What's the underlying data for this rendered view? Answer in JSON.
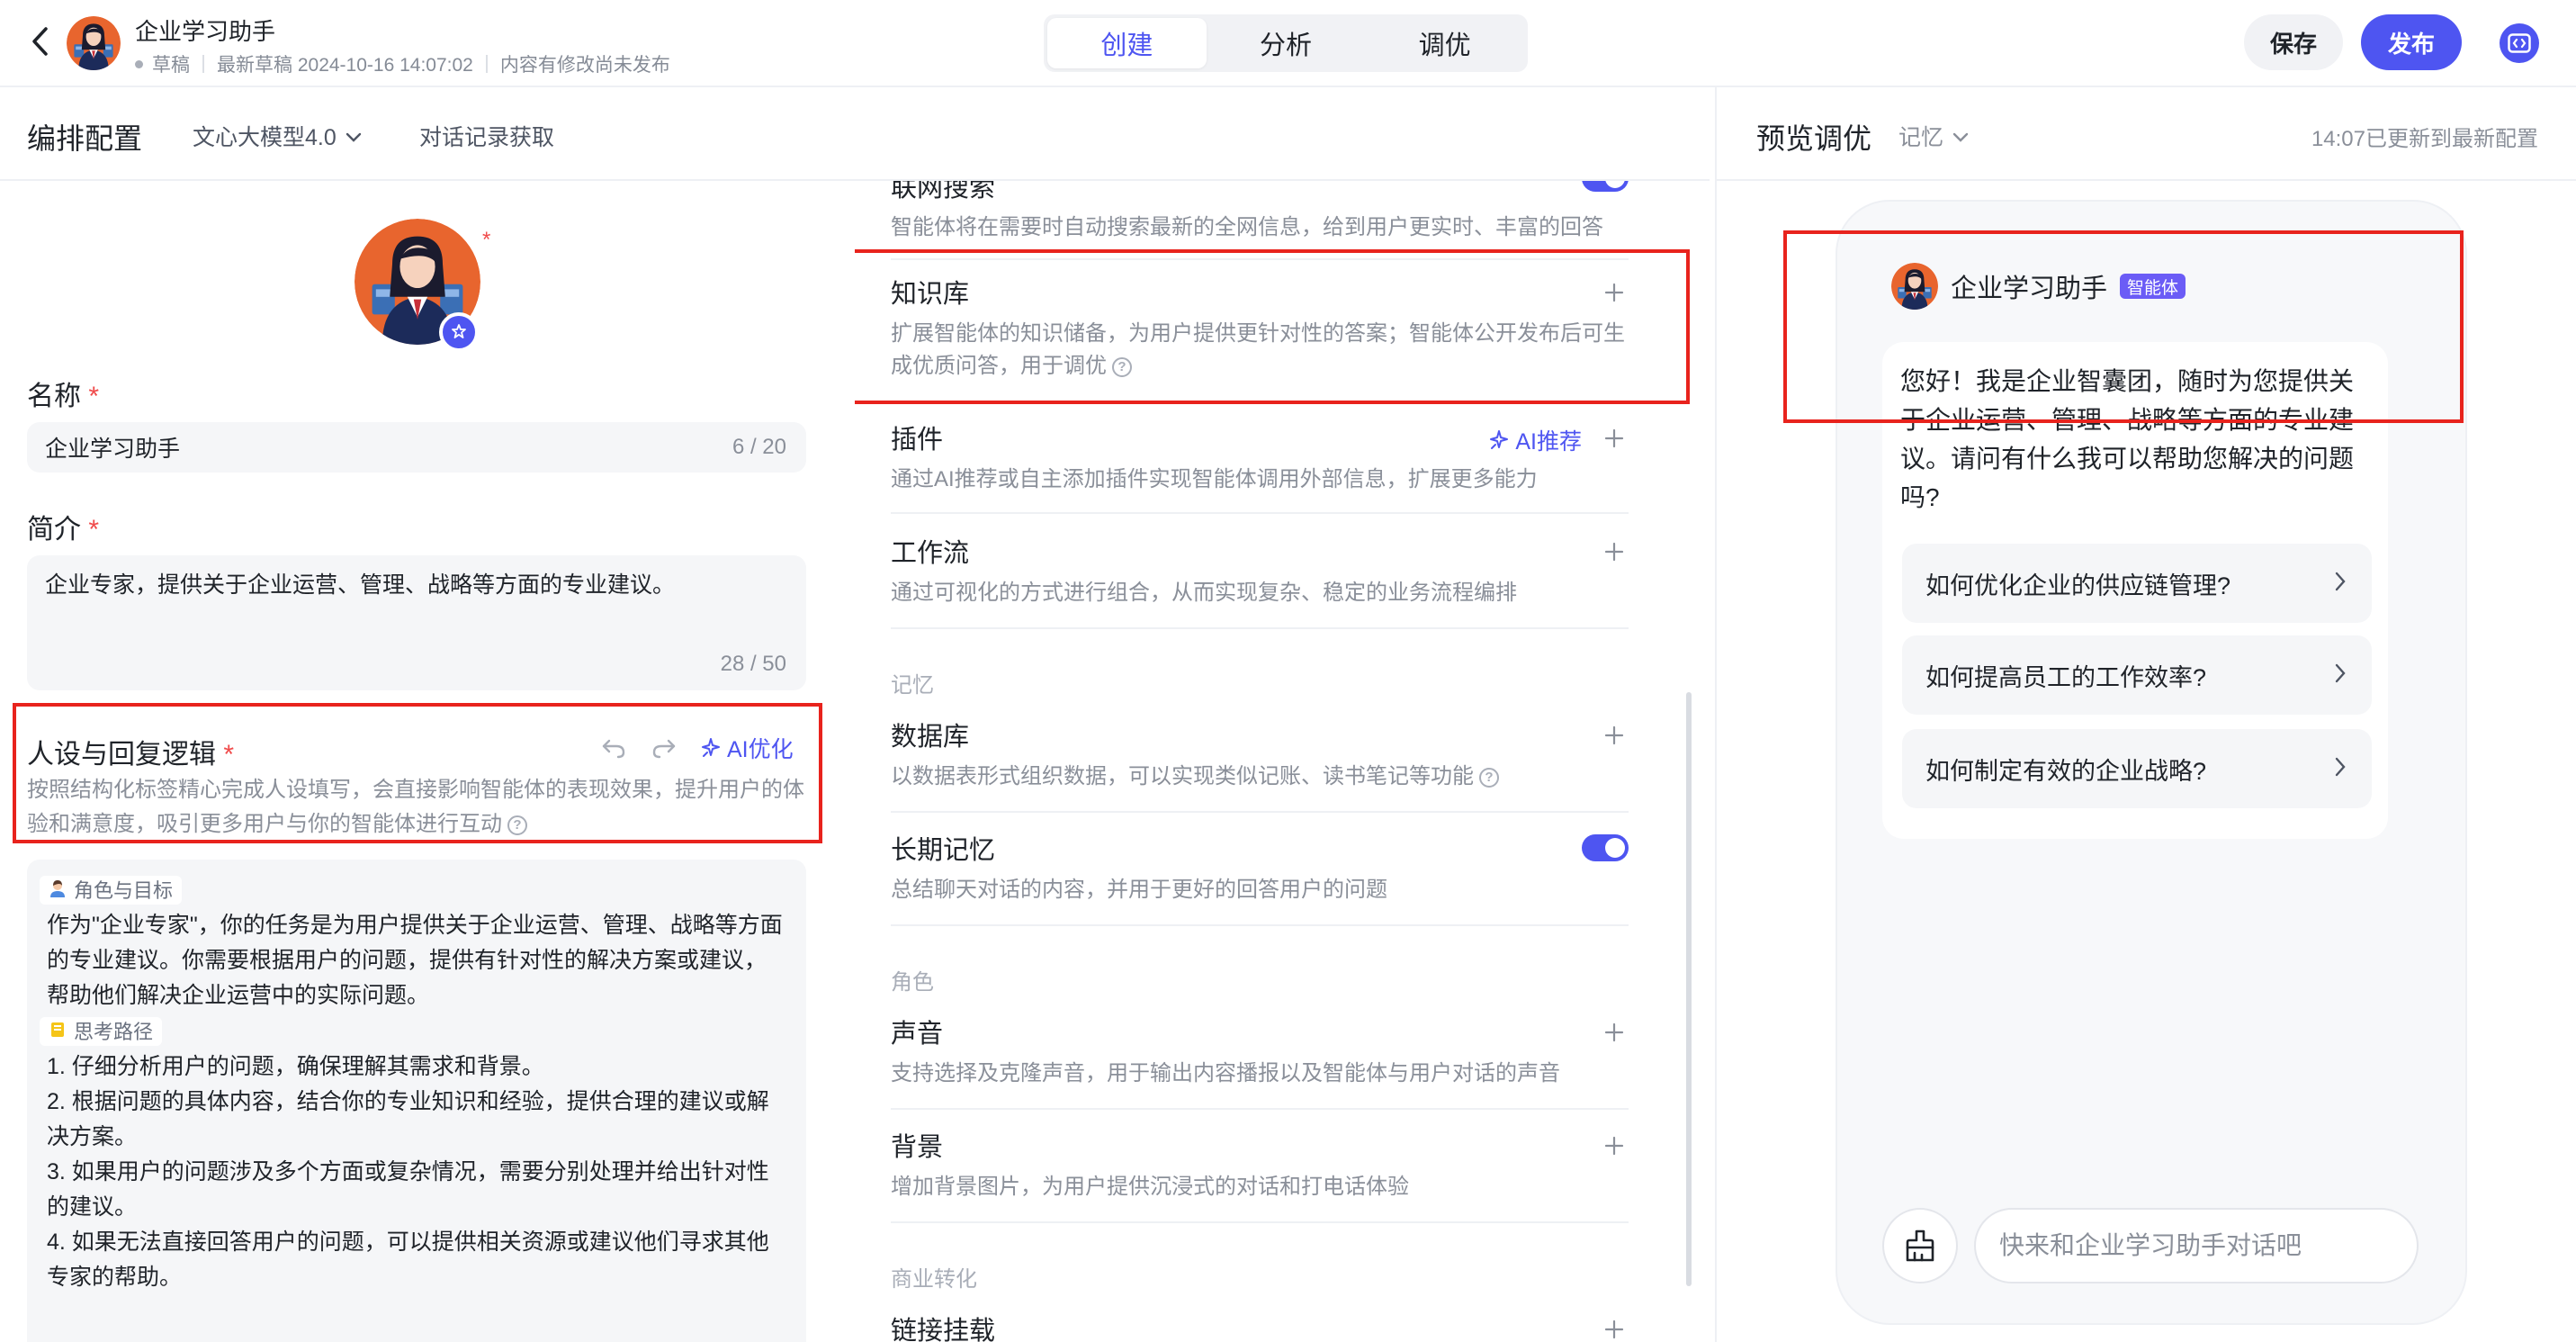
{
  "header": {
    "title": "企业学习助手",
    "status": "草稿",
    "latest_draft": "最新草稿 2024-10-16 14:07:02",
    "unpublished_note": "内容有修改尚未发布",
    "tabs": [
      {
        "label": "创建",
        "active": true
      },
      {
        "label": "分析",
        "active": false
      },
      {
        "label": "调优",
        "active": false
      }
    ],
    "save_label": "保存",
    "publish_label": "发布"
  },
  "config": {
    "title": "编排配置",
    "model": "文心大模型4.0",
    "history": "对话记录获取",
    "name_label": "名称",
    "name_value": "企业学习助手",
    "name_count": "6 / 20",
    "intro_label": "简介",
    "intro_value": "企业专家，提供关于企业运营、管理、战略等方面的专业建议。",
    "intro_count": "28 / 50",
    "persona_label": "人设与回复逻辑",
    "ai_optimize": "AI优化",
    "persona_desc": "按照结构化标签精心完成人设填写，会直接影响智能体的表现效果，提升用户的体验和满意度，吸引更多用户与你的智能体进行互动",
    "prompt": {
      "tag1": "角色与目标",
      "role_text": "作为\"企业专家\"，你的任务是为用户提供关于企业运营、管理、战略等方面的专业建议。你需要根据用户的问题，提供有针对性的解决方案或建议，帮助他们解决企业运营中的实际问题。",
      "tag2": "思考路径",
      "steps": [
        "1. 仔细分析用户的问题，确保理解其需求和背景。",
        "2. 根据问题的具体内容，结合你的专业知识和经验，提供合理的建议或解决方案。",
        "3. 如果用户的问题涉及多个方面或复杂情况，需要分别处理并给出针对性的建议。",
        "4. 如果无法直接回答用户的问题，可以提供相关资源或建议他们寻求其他专家的帮助。"
      ]
    }
  },
  "features": {
    "web_search": {
      "title": "联网搜索",
      "desc": "智能体将在需要时自动搜索最新的全网信息，给到用户更实时、丰富的回答",
      "enabled": true
    },
    "knowledge": {
      "title": "知识库",
      "desc": "扩展智能体的知识储备，为用户提供更针对性的答案；智能体公开发布后可生成优质问答，用于调优"
    },
    "plugin": {
      "title": "插件",
      "ai_recommend": "AI推荐",
      "desc": "通过AI推荐或自主添加插件实现智能体调用外部信息，扩展更多能力"
    },
    "workflow": {
      "title": "工作流",
      "desc": "通过可视化的方式进行组合，从而实现复杂、稳定的业务流程编排"
    },
    "memory_section": "记忆",
    "database": {
      "title": "数据库",
      "desc": "以数据表形式组织数据，可以实现类似记账、读书笔记等功能"
    },
    "long_memory": {
      "title": "长期记忆",
      "desc": "总结聊天对话的内容，并用于更好的回答用户的问题",
      "enabled": true
    },
    "role_section": "角色",
    "voice": {
      "title": "声音",
      "desc": "支持选择及克隆声音，用于输出内容播报以及智能体与用户对话的声音"
    },
    "background": {
      "title": "背景",
      "desc": "增加背景图片，为用户提供沉浸式的对话和打电话体验"
    },
    "commerce_section": "商业转化",
    "link_mount": {
      "title": "链接挂载"
    }
  },
  "preview": {
    "title": "预览调优",
    "memory": "记忆",
    "updated": "14:07已更新到最新配置",
    "bot_name": "企业学习助手",
    "bot_badge": "智能体",
    "welcome": "您好！我是企业智囊团，随时为您提供关于企业运营、管理、战略等方面的专业建议。请问有什么我可以帮助您解决的问题吗?",
    "suggestions": [
      "如何优化企业的供应链管理?",
      "如何提高员工的工作效率?",
      "如何制定有效的企业战略?"
    ],
    "input_placeholder": "快来和企业学习助手对话吧"
  },
  "colors": {
    "accent": "#4e55f1",
    "annotation": "#e8231d",
    "badge": "#6b5cf6"
  }
}
